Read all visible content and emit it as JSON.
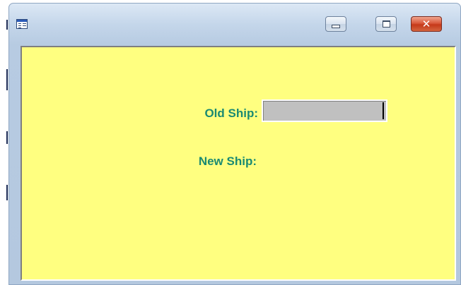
{
  "window": {
    "title": "",
    "icon": "form-window-icon",
    "controls": {
      "minimize": "minimize-icon",
      "maximize": "maximize-icon",
      "close": "close-icon",
      "close_glyph": "✕"
    }
  },
  "form": {
    "background_color": "#ffff80",
    "label_color": "#1a8a72",
    "old_ship_label": "Old Ship:",
    "old_ship_value": "",
    "new_ship_label": "New Ship:"
  }
}
